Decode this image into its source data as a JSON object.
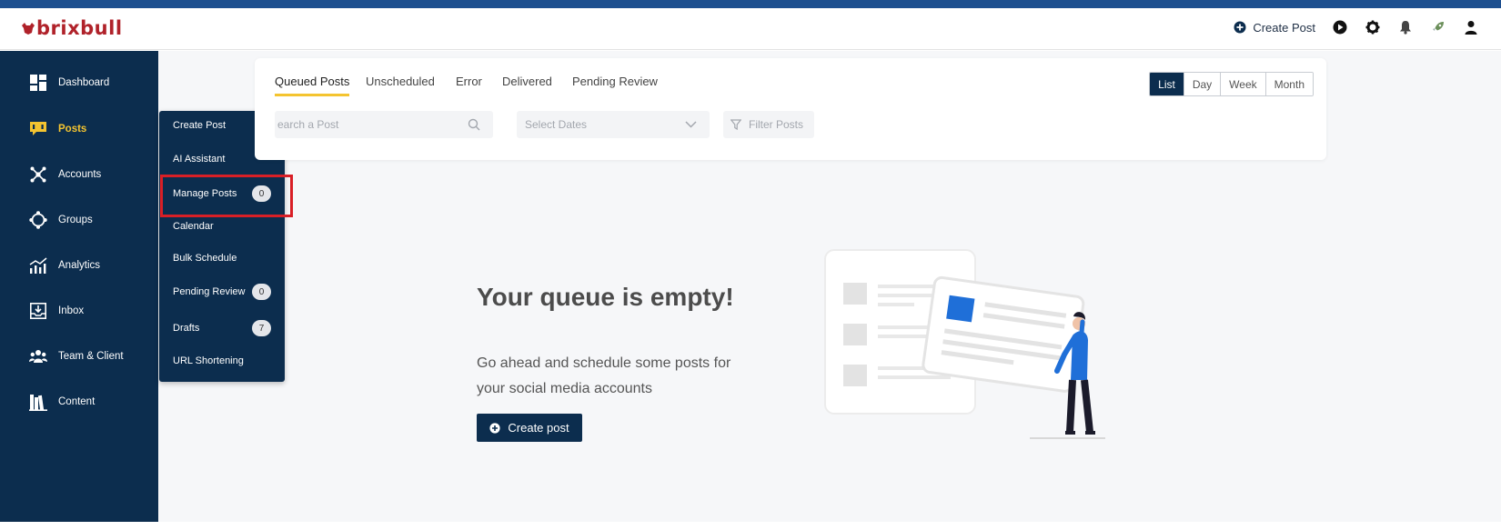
{
  "header": {
    "logo_text": "brixbull",
    "create_post_label": "Create Post",
    "icons": [
      "plus-circle-icon",
      "play-icon",
      "gear-icon",
      "bell-icon",
      "rocket-icon",
      "user-icon"
    ]
  },
  "sidebar": {
    "items": [
      {
        "label": "Dashboard",
        "icon": "dashboard-icon"
      },
      {
        "label": "Posts",
        "icon": "posts-icon",
        "active": true
      },
      {
        "label": "Accounts",
        "icon": "accounts-icon"
      },
      {
        "label": "Groups",
        "icon": "groups-icon"
      },
      {
        "label": "Analytics",
        "icon": "analytics-icon"
      },
      {
        "label": "Inbox",
        "icon": "inbox-icon"
      },
      {
        "label": "Team & Client",
        "icon": "team-icon"
      },
      {
        "label": "Content",
        "icon": "content-icon"
      }
    ]
  },
  "submenu": {
    "items": [
      {
        "label": "Create Post"
      },
      {
        "label": "AI Assistant"
      },
      {
        "label": "Manage Posts",
        "badge": "0"
      },
      {
        "label": "Calendar"
      },
      {
        "label": "Bulk Schedule"
      },
      {
        "label": "Pending Review",
        "badge": "0"
      },
      {
        "label": "Drafts",
        "badge": "7"
      },
      {
        "label": "URL Shortening"
      }
    ]
  },
  "tabs": [
    "Queued Posts",
    "Unscheduled",
    "Error",
    "Delivered",
    "Pending Review"
  ],
  "active_tab": "Queued Posts",
  "view_modes": [
    "List",
    "Day",
    "Week",
    "Month"
  ],
  "active_view": "List",
  "filters": {
    "search_placeholder": "Search a Post",
    "search_visible": "earch a Post",
    "dates_placeholder": "Select Dates",
    "filter_label": "Filter Posts"
  },
  "empty_state": {
    "title": "Your queue is empty!",
    "description_line1": "Go ahead and schedule some posts for",
    "description_line2": "your social media accounts",
    "button_label": "Create post"
  },
  "colors": {
    "sidebar_bg": "#0c2d4e",
    "accent_yellow": "#f4c430",
    "brand_red": "#b0222a",
    "highlight_red": "#d91f26",
    "illustration_blue": "#1f6fd8"
  }
}
